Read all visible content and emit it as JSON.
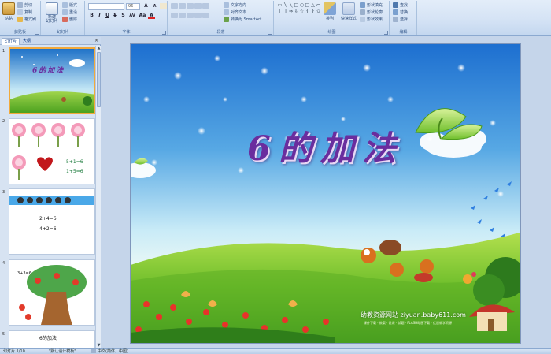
{
  "ribbon": {
    "clipboard": {
      "paste": "粘贴",
      "cut": "剪切",
      "copy": "复制",
      "format_painter": "格式刷",
      "label": "剪贴板"
    },
    "slides": {
      "new_slide": "新建\n幻灯片",
      "layout": "版式",
      "reset": "重设",
      "delete": "删除",
      "label": "幻灯片"
    },
    "font": {
      "font_name": "",
      "font_size": "96",
      "bold": "B",
      "italic": "I",
      "underline": "U",
      "strike": "S",
      "shadow": "S",
      "spacing": "AV",
      "case": "Aa",
      "color": "A",
      "label": "字体"
    },
    "paragraph": {
      "text_direction": "文字方向",
      "align_text": "对齐文本",
      "smartart": "转换为 SmartArt",
      "label": "段落"
    },
    "drawing": {
      "arrange": "排列",
      "quick_styles": "快速样式",
      "shape_fill": "形状填充",
      "shape_outline": "形状轮廓",
      "shape_effects": "形状效果",
      "label": "绘图"
    },
    "editing": {
      "find": "查找",
      "replace": "替换",
      "select": "选择",
      "label": "编辑"
    }
  },
  "panel": {
    "tab_slides": "幻灯片",
    "tab_outline": "大纲",
    "close": "×",
    "thumbs": [
      {
        "num": "1",
        "title": "6的加法"
      },
      {
        "num": "2",
        "eq1": "5+1=6",
        "eq2": "1+5=6"
      },
      {
        "num": "3",
        "eq1": "2+4=6",
        "eq2": "4+2=6"
      },
      {
        "num": "4",
        "label": "3+3=6"
      },
      {
        "num": "5",
        "title": "6的加法"
      }
    ]
  },
  "slide": {
    "title": "6的加法",
    "watermark": "幼教资源网站 ziyuan.baby611.com",
    "watermark_sub": "课件下载 · 教案 · 说课 · 试题 · FLASH动画下载 · 优质教学资源"
  },
  "status": {
    "slide_info": "幻灯片 1/10",
    "theme": "\"默认设计模板\"",
    "language": "中文(简体，中国)"
  },
  "colors": {
    "ribbon_bg": "#dbe7f6",
    "accent": "#15428b",
    "title_purple": "#6a2d9e"
  }
}
